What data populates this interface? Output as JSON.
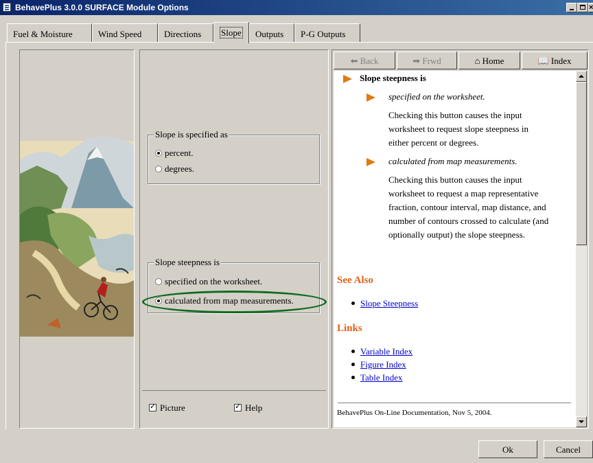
{
  "window": {
    "title": "BehavePlus 3.0.0 SURFACE Module Options"
  },
  "tabs": [
    {
      "label": "Fuel & Moisture"
    },
    {
      "label": "Wind Speed"
    },
    {
      "label": "Directions"
    },
    {
      "label": "Slope",
      "active": true
    },
    {
      "label": "Outputs"
    },
    {
      "label": "P-G Outputs"
    }
  ],
  "slope_specified": {
    "legend": "Slope is specified as",
    "options": [
      {
        "label": "percent.",
        "checked": true
      },
      {
        "label": "degrees.",
        "checked": false
      }
    ]
  },
  "slope_steepness": {
    "legend": "Slope steepness is",
    "options": [
      {
        "label": "specified on the worksheet.",
        "checked": false
      },
      {
        "label": "calculated from map measurements.",
        "checked": true
      }
    ]
  },
  "display_options": {
    "picture_label": "Picture",
    "picture_checked": true,
    "help_label": "Help",
    "help_checked": true
  },
  "help_toolbar": {
    "back": "Back",
    "forward": "Frwd",
    "home": "Home",
    "index": "Index"
  },
  "help": {
    "heading": "Slope steepness is",
    "item1_title": "specified on the worksheet.",
    "item1_lines": [
      "Checking this button causes the input",
      "worksheet to request slope steepness in",
      "either percent or degrees."
    ],
    "item2_title": "calculated from map measurements.",
    "item2_lines": [
      "Checking this button causes the input",
      "worksheet to request a map representative",
      "fraction, contour interval, map distance, and",
      "number of contours crossed to calculate (and",
      "optionally output) the slope steepness."
    ],
    "see_also_heading": "See Also",
    "see_also_links": [
      "Slope Steepness"
    ],
    "links_heading": "Links",
    "links": [
      "Variable Index",
      "Figure Index",
      "Table Index"
    ],
    "footer": "BehavePlus On-Line Documentation, Nov 5, 2004."
  },
  "buttons": {
    "ok": "Ok",
    "cancel": "Cancel"
  },
  "colors": {
    "accent_orange": "#e0601a",
    "highlight_green": "#0f6b1e",
    "link_blue": "#0000cc"
  }
}
